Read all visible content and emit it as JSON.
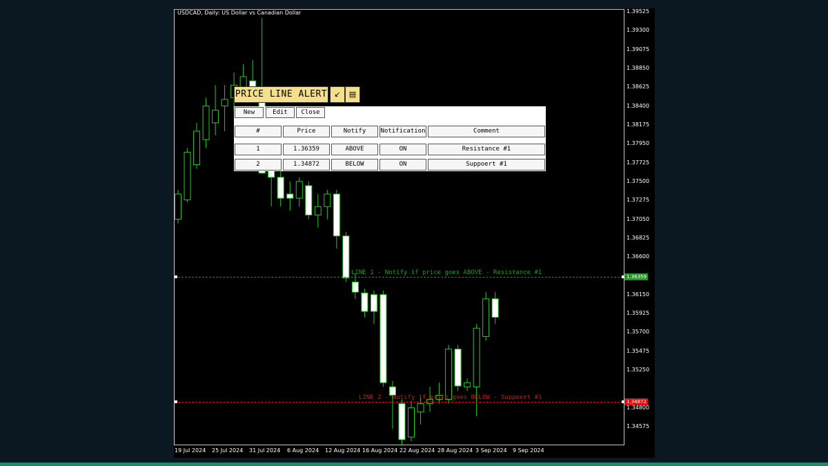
{
  "chart": {
    "title": "USDCAD, Daily:  US Dollar vs Canadian Dollar",
    "price_ticks": [
      "1.39525",
      "1.39300",
      "1.39075",
      "1.38850",
      "1.38625",
      "1.38400",
      "1.38175",
      "1.37950",
      "1.37725",
      "1.37500",
      "1.37275",
      "1.37050",
      "1.36825",
      "1.36600",
      "1.36150",
      "1.35925",
      "1.35700",
      "1.35475",
      "1.35250",
      "1.34800",
      "1.34575"
    ],
    "date_ticks": [
      "19 Jul 2024",
      "25 Jul 2024",
      "31 Jul 2024",
      "6 Aug 2024",
      "12 Aug 2024",
      "16 Aug 2024",
      "22 Aug 2024",
      "28 Aug 2024",
      "3 Sep 2024",
      "9 Sep 2024"
    ],
    "line1": {
      "label": "LINE 1 - Notify if price goes ABOVE - Resistance #1",
      "price_tag": "1.36359",
      "color": "#1e9a1e"
    },
    "line2": {
      "label": "LINE 2 - Notify if price goes BELOW - Suppoert #1",
      "price_tag": "1.34872",
      "color": "#e01010"
    },
    "colors": {
      "bull_body": "#000000",
      "bear_body": "#ffffff",
      "wick": "#22cc22",
      "grid_bg": "#000000"
    }
  },
  "panel": {
    "title": "PRICE LINE ALERT",
    "minimize_icon": "minimize-icon",
    "window_icon": "window-icon",
    "buttons": {
      "new": "New",
      "edit": "Edit",
      "close": "Close"
    },
    "headers": [
      "#",
      "Price",
      "Notify",
      "Notification",
      "Comment"
    ],
    "rows": [
      [
        "1",
        "1.36359",
        "ABOVE",
        "ON",
        "Resistance #1"
      ],
      [
        "2",
        "1.34872",
        "BELOW",
        "ON",
        "Suppoert #1"
      ]
    ]
  },
  "chart_data": {
    "type": "candlestick",
    "symbol": "USDCAD",
    "timeframe": "Daily",
    "candles": [
      {
        "o": 1.3705,
        "h": 1.374,
        "l": 1.37,
        "c": 1.3735
      },
      {
        "o": 1.3728,
        "h": 1.379,
        "l": 1.3725,
        "c": 1.3785
      },
      {
        "o": 1.377,
        "h": 1.382,
        "l": 1.3765,
        "c": 1.381
      },
      {
        "o": 1.38,
        "h": 1.385,
        "l": 1.379,
        "c": 1.384
      },
      {
        "o": 1.382,
        "h": 1.3865,
        "l": 1.3805,
        "c": 1.3835
      },
      {
        "o": 1.384,
        "h": 1.3865,
        "l": 1.381,
        "c": 1.3848
      },
      {
        "o": 1.385,
        "h": 1.388,
        "l": 1.3835,
        "c": 1.3865
      },
      {
        "o": 1.386,
        "h": 1.389,
        "l": 1.3845,
        "c": 1.3875
      },
      {
        "o": 1.387,
        "h": 1.3895,
        "l": 1.385,
        "c": 1.3858
      },
      {
        "o": 1.3855,
        "h": 1.3945,
        "l": 1.376,
        "c": 1.376
      },
      {
        "o": 1.3765,
        "h": 1.378,
        "l": 1.372,
        "c": 1.3755
      },
      {
        "o": 1.3755,
        "h": 1.377,
        "l": 1.372,
        "c": 1.373
      },
      {
        "o": 1.3735,
        "h": 1.375,
        "l": 1.3715,
        "c": 1.373
      },
      {
        "o": 1.373,
        "h": 1.3755,
        "l": 1.372,
        "c": 1.375
      },
      {
        "o": 1.3745,
        "h": 1.375,
        "l": 1.3705,
        "c": 1.371
      },
      {
        "o": 1.371,
        "h": 1.3735,
        "l": 1.3695,
        "c": 1.372
      },
      {
        "o": 1.372,
        "h": 1.374,
        "l": 1.3705,
        "c": 1.3735
      },
      {
        "o": 1.3735,
        "h": 1.374,
        "l": 1.367,
        "c": 1.3685
      },
      {
        "o": 1.3685,
        "h": 1.369,
        "l": 1.363,
        "c": 1.3635
      },
      {
        "o": 1.363,
        "h": 1.364,
        "l": 1.361,
        "c": 1.3618
      },
      {
        "o": 1.3617,
        "h": 1.3622,
        "l": 1.3588,
        "c": 1.3595
      },
      {
        "o": 1.3615,
        "h": 1.362,
        "l": 1.358,
        "c": 1.3595
      },
      {
        "o": 1.3615,
        "h": 1.362,
        "l": 1.3505,
        "c": 1.351
      },
      {
        "o": 1.3505,
        "h": 1.3512,
        "l": 1.3455,
        "c": 1.3495
      },
      {
        "o": 1.3485,
        "h": 1.349,
        "l": 1.3435,
        "c": 1.3442
      },
      {
        "o": 1.3445,
        "h": 1.3488,
        "l": 1.344,
        "c": 1.348
      },
      {
        "o": 1.3475,
        "h": 1.3495,
        "l": 1.346,
        "c": 1.3485
      },
      {
        "o": 1.3485,
        "h": 1.3505,
        "l": 1.3475,
        "c": 1.349
      },
      {
        "o": 1.349,
        "h": 1.351,
        "l": 1.3485,
        "c": 1.3495
      },
      {
        "o": 1.349,
        "h": 1.3555,
        "l": 1.3485,
        "c": 1.355
      },
      {
        "o": 1.355,
        "h": 1.3555,
        "l": 1.35,
        "c": 1.3506
      },
      {
        "o": 1.3505,
        "h": 1.3515,
        "l": 1.35,
        "c": 1.351
      },
      {
        "o": 1.3505,
        "h": 1.358,
        "l": 1.347,
        "c": 1.3575
      },
      {
        "o": 1.3565,
        "h": 1.3618,
        "l": 1.356,
        "c": 1.361
      },
      {
        "o": 1.361,
        "h": 1.3618,
        "l": 1.358,
        "c": 1.3588
      }
    ],
    "hlines": [
      {
        "price": 1.36359,
        "label": "LINE 1 - Notify if price goes ABOVE - Resistance #1"
      },
      {
        "price": 1.34872,
        "label": "LINE 2 - Notify if price goes BELOW - Suppoert #1"
      }
    ],
    "ylim": [
      1.3445,
      1.39525
    ]
  }
}
